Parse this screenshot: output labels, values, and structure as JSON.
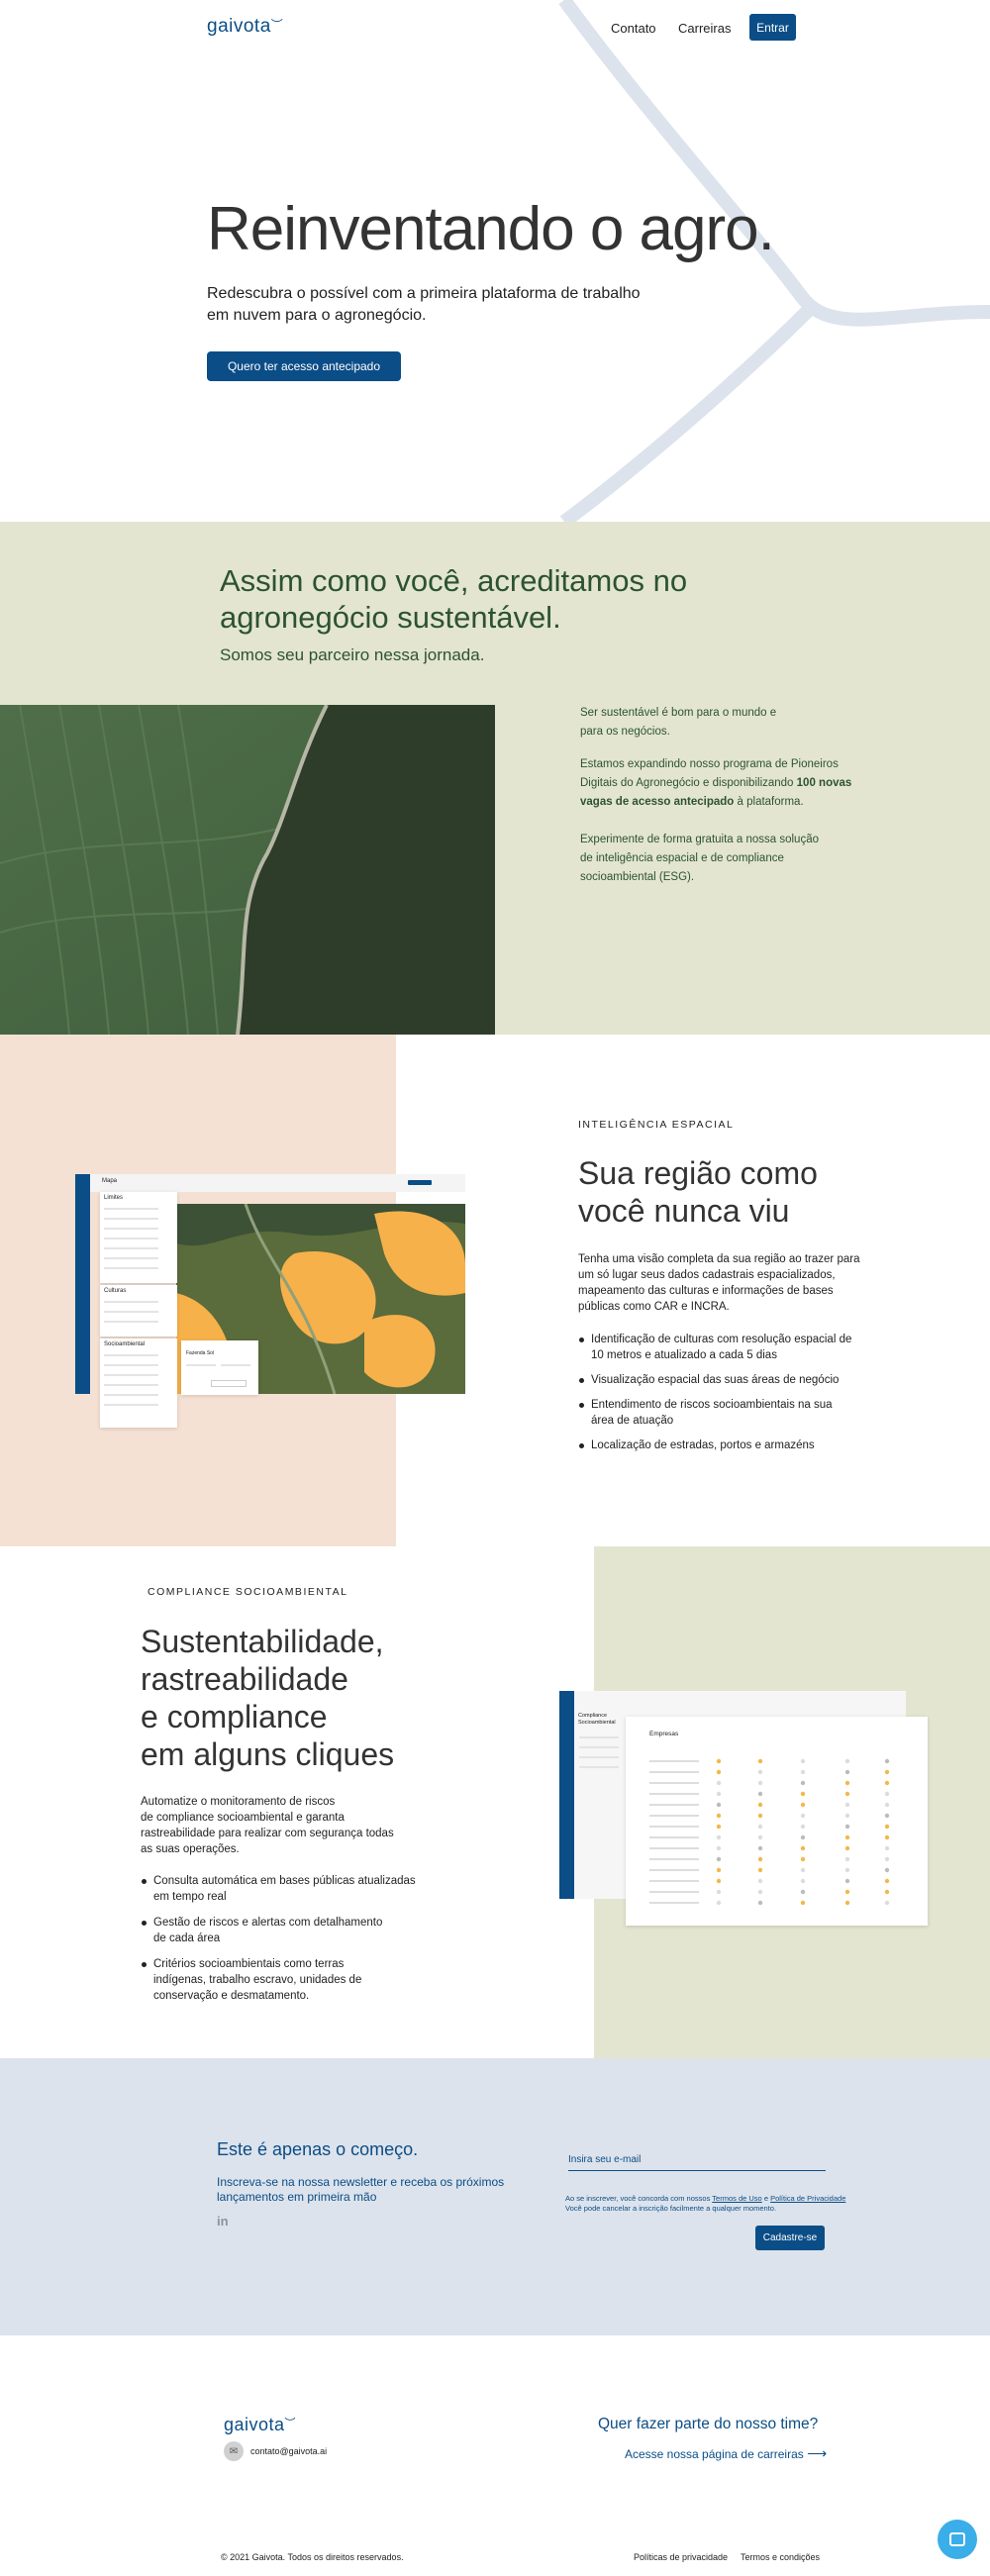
{
  "header": {
    "logo": "gaivota",
    "nav": [
      "Contato",
      "Carreiras"
    ],
    "login_label": "Entrar"
  },
  "hero": {
    "title": "Reinventando o agro.",
    "subtitle_line1": "Redescubra o possível com a primeira plataforma de trabalho",
    "subtitle_line2": "em nuvem para o agronegócio.",
    "cta_label": "Quero ter acesso antecipado"
  },
  "sustainable": {
    "title_line1": "Assim como você, acreditamos no",
    "title_line2": "agronegócio sustentável.",
    "subtitle": "Somos seu parceiro nessa jornada.",
    "p1_line1": "Ser sustentável é bom para o mundo e",
    "p1_line2": "para os negócios.",
    "p2_line1": "Estamos expandindo nosso programa de Pioneiros",
    "p2_line2": "Digitais do Agronegócio e disponibilizando",
    "p2_bold1": "100 novas",
    "p2_bold2": "vagas de acesso antecipado",
    "p2_end": "à plataforma.",
    "p3_line1": "Experimente de forma gratuita a nossa solução",
    "p3_line2": "de inteligência espacial e de compliance",
    "p3_line3": "socioambiental (ESG)."
  },
  "spatial": {
    "eyebrow": "INTELIGÊNCIA ESPACIAL",
    "title_line1": "Sua região como",
    "title_line2": "você nunca viu",
    "body_lines": [
      "Tenha uma visão completa da sua região ao trazer para",
      "um só lugar seus dados cadastrais espacializados,",
      "mapeamento das culturas e informações de bases",
      "públicas como CAR e INCRA."
    ],
    "bullets": [
      [
        "Identificação de culturas com resolução espacial de",
        "10 metros e atualizado a cada 5 dias"
      ],
      [
        "Visualização espacial das suas áreas de negócio"
      ],
      [
        "Entendimento de riscos socioambientais na sua",
        "área de atuação"
      ],
      [
        "Localização de estradas, portos e armazéns"
      ]
    ],
    "mock": {
      "app_title": "Mapa",
      "panel1": "Limites",
      "panel2": "Culturas",
      "panel3": "Socioambiental",
      "popup": "Fazenda Sol"
    }
  },
  "compliance": {
    "eyebrow": "COMPLIANCE SOCIOAMBIENTAL",
    "title_lines": [
      "Sustentabilidade,",
      "rastreabilidade",
      "e compliance",
      "em alguns cliques"
    ],
    "body_lines": [
      "Automatize o monitoramento de riscos",
      "de compliance socioambiental e garanta",
      "rastreabilidade para realizar com segurança todas",
      "as suas operações."
    ],
    "bullets": [
      [
        "Consulta automática em bases públicas atualizadas",
        "em tempo real"
      ],
      [
        "Gestão de riscos e alertas com detalhamento",
        "de cada área"
      ],
      [
        "Critérios socioambientais como terras",
        "indígenas, trabalho escravo, unidades de",
        "conservação e desmatamento."
      ]
    ],
    "mock": {
      "sidebar_title1": "Compliance",
      "sidebar_title2": "Socioambiental",
      "table_title": "Empresas"
    }
  },
  "newsletter": {
    "title": "Este é apenas o começo.",
    "subtitle_line1": "Inscreva-se na nossa newsletter e receba os próximos",
    "subtitle_line2": "lançamentos em primeira mão",
    "social": "in",
    "email_placeholder": "Insira seu e-mail",
    "consent_a": "Ao se inscrever, você concorda com nossos",
    "consent_terms": "Termos de Uso",
    "consent_and": "e",
    "consent_privacy": "Política de Privacidade",
    "consent_b": "Você pode cancelar a inscrição facilmente a qualquer momento.",
    "submit_label": "Cadastre-se"
  },
  "footer": {
    "logo": "gaivota",
    "email": "contato@gaivota.ai",
    "careers_title": "Quer fazer parte do nosso time?",
    "careers_link": "Acesse nossa página de carreiras",
    "copyright": "© 2021 Gaivota. Todos os direitos reservados.",
    "privacy": "Políticas de privacidade",
    "terms": "Termos e condições"
  },
  "colors": {
    "brand_blue": "#0b4d86",
    "sage": "#e3e5d0",
    "peach": "#f5e1d4",
    "newsletter_bg": "#dce3ec",
    "forest_green": "#2c5330"
  }
}
